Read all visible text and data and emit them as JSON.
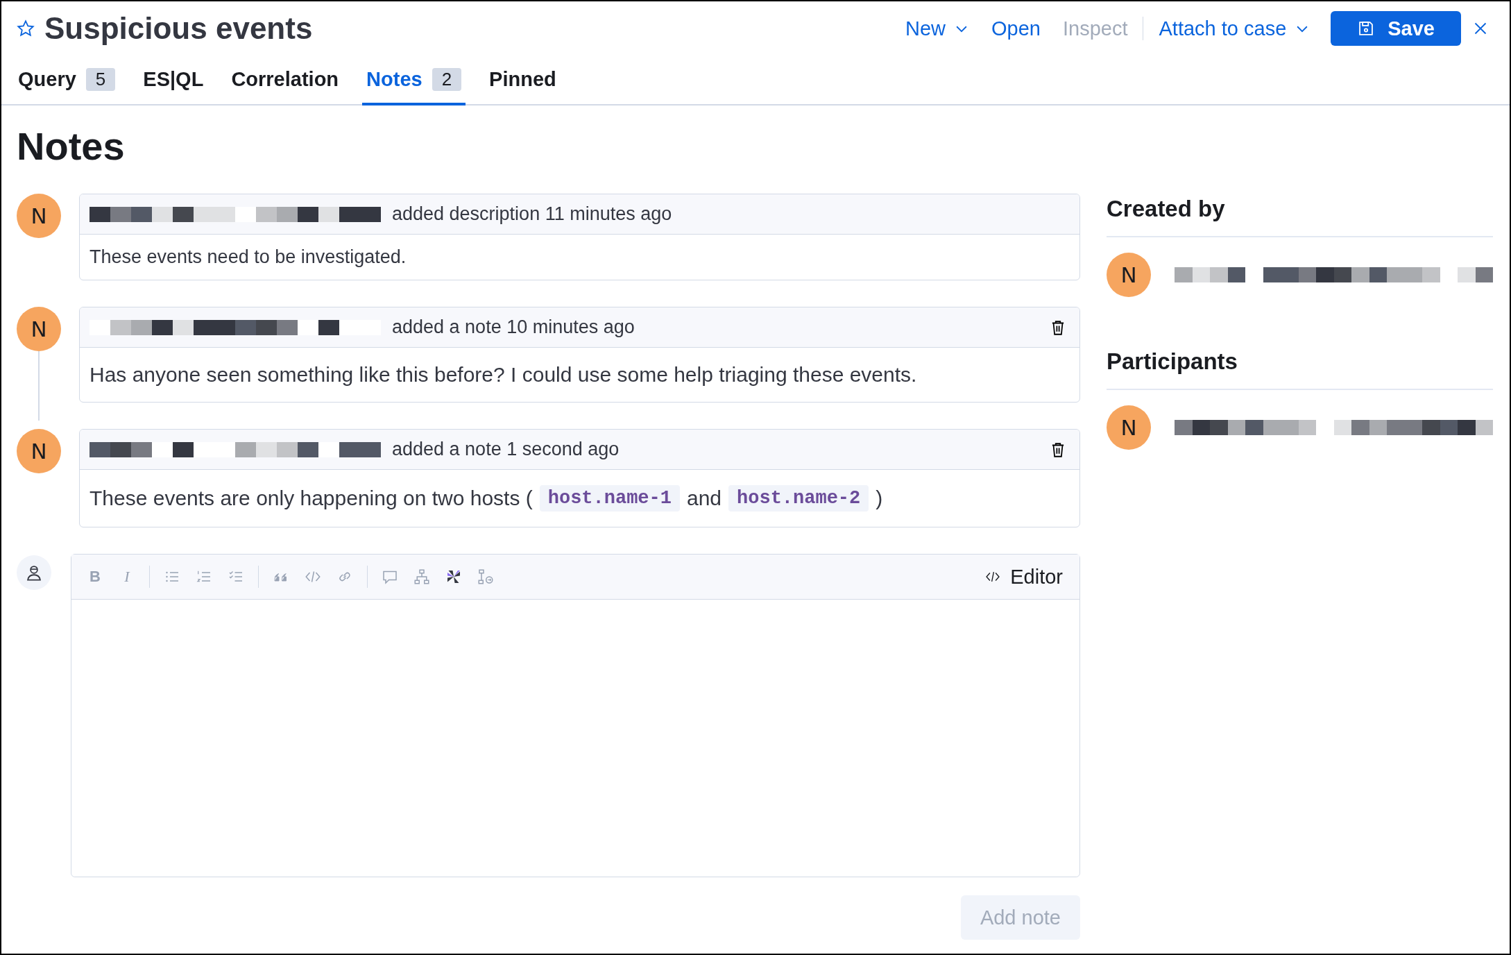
{
  "header": {
    "title": "Suspicious events",
    "favorite": false,
    "actions": [
      {
        "label": "New",
        "kind": "menu",
        "disabled": false
      },
      {
        "label": "Open",
        "kind": "link",
        "disabled": false
      },
      {
        "label": "Inspect",
        "kind": "link",
        "disabled": true
      },
      {
        "label": "Attach to case",
        "kind": "menu",
        "disabled": false
      }
    ],
    "save_button": "Save"
  },
  "tabs": [
    {
      "label": "Query",
      "count": "5",
      "selected": false
    },
    {
      "label": "ES|QL",
      "selected": false
    },
    {
      "label": "Correlation",
      "selected": false
    },
    {
      "label": "Notes",
      "count": "2",
      "selected": true
    },
    {
      "label": "Pinned",
      "selected": false
    }
  ],
  "heading": "Notes",
  "notes": [
    {
      "author_initial": "N",
      "action": "added description 11 minutes ago",
      "deletable": false,
      "body": [
        {
          "kind": "text",
          "text": "These events need to be investigated."
        }
      ]
    },
    {
      "author_initial": "N",
      "action": "added a note 10 minutes ago",
      "deletable": true,
      "body": [
        {
          "kind": "text",
          "text": "Has anyone seen something like this before? I could use some help triaging these events."
        }
      ]
    },
    {
      "author_initial": "N",
      "action": "added a note 1 second ago",
      "deletable": true,
      "body": [
        {
          "kind": "text",
          "text": "These events are only happening on two hosts ("
        },
        {
          "kind": "code",
          "text": "host.name-1"
        },
        {
          "kind": "text",
          "text": "and"
        },
        {
          "kind": "code",
          "text": "host.name-2"
        },
        {
          "kind": "text",
          "text": ")"
        }
      ]
    }
  ],
  "editor": {
    "toolbar": [
      {
        "kind": "bold",
        "label": "B"
      },
      {
        "kind": "italic",
        "label": "I"
      },
      {
        "kind": "separator"
      },
      {
        "kind": "bullet-list"
      },
      {
        "kind": "numbered-list"
      },
      {
        "kind": "task-list"
      },
      {
        "kind": "separator"
      },
      {
        "kind": "quote"
      },
      {
        "kind": "code"
      },
      {
        "kind": "link"
      },
      {
        "kind": "separator"
      },
      {
        "kind": "comment"
      },
      {
        "kind": "tree"
      },
      {
        "kind": "logo"
      },
      {
        "kind": "tree-arrow"
      }
    ],
    "mode_button": "Editor"
  },
  "add_note_button": {
    "label": "Add note",
    "disabled": true
  },
  "sidebar": {
    "sections": [
      {
        "title": "Created by",
        "users": [
          {
            "initial": "N"
          }
        ]
      },
      {
        "title": "Participants",
        "users": [
          {
            "initial": "N"
          }
        ]
      }
    ]
  }
}
